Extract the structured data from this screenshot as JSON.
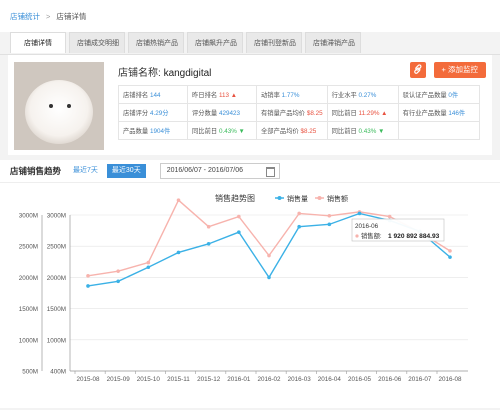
{
  "breadcrumb": {
    "root": "店铺统计",
    "current": "店铺详情"
  },
  "tabs": [
    {
      "label": "店铺详情",
      "active": true
    },
    {
      "label": "店铺成交明细",
      "active": false
    },
    {
      "label": "店铺热销产品",
      "active": false
    },
    {
      "label": "店铺飙升产品",
      "active": false
    },
    {
      "label": "店铺刊登新品",
      "active": false
    },
    {
      "label": "店铺滞销产品",
      "active": false
    }
  ],
  "shop": {
    "name_label": "店铺名称:",
    "name": "kangdigital",
    "monitor_button": "+ 添加监控"
  },
  "stats": {
    "r1": {
      "a_label": "店铺排名",
      "a_val": "144",
      "b_label": "昨日排名",
      "b_val": "113",
      "c_label": "动销率",
      "c_val": "1.77%",
      "d_label": "行业水平",
      "d_val": "0.27%",
      "e_label": "驳认证产品数量",
      "e_val": "0件"
    },
    "r2": {
      "a_label": "店铺评分",
      "a_val": "4.29分",
      "b_label": "评分数量",
      "b_val": "429423",
      "c_label": "有销量产品均价",
      "c_val": "$8.25",
      "d_label": "同比前日",
      "d_val": "11.29%",
      "e_label": "有行业产品数量",
      "e_val": "146件"
    },
    "r3": {
      "a_label": "产品数量",
      "a_val": "1904件",
      "b_label": "同比前日",
      "b_val": "0.43%",
      "c_label": "全部产品均价",
      "c_val": "$8.25",
      "d_label": "同比前日",
      "d_val": "0.43%"
    }
  },
  "trend": {
    "title": "店铺销售趋势",
    "range_7": "最近7天",
    "range_30": "最近30天",
    "date_range": "2016/06/07 - 2016/07/06"
  },
  "colors": {
    "volume": "#3bb1e6",
    "amount": "#f7b3ad",
    "accent": "#f36b3b",
    "link": "#3a8fd8"
  },
  "chart_data": {
    "type": "line",
    "title": "销售趋势图",
    "categories": [
      "2015-08",
      "2015-09",
      "2015-10",
      "2015-11",
      "2015-12",
      "2016-01",
      "2016-02",
      "2016-03",
      "2016-04",
      "2016-05",
      "2016-06",
      "2016-07",
      "2016-08"
    ],
    "series": [
      {
        "name": "销售量",
        "values": [
          945,
          975,
          1065,
          1160,
          1215,
          1290,
          1000,
          1325,
          1340,
          1410,
          1365,
          1295,
          1130
        ]
      },
      {
        "name": "销售额",
        "values": [
          1010,
          1040,
          1095,
          1495,
          1325,
          1390,
          1140,
          1410,
          1395,
          1420,
          1390,
          1290,
          1170
        ]
      }
    ],
    "ylim": [
      400,
      1400
    ],
    "y_ticks": [
      "400M",
      "1000M",
      "1500M",
      "2000M",
      "2500M",
      "3000M"
    ],
    "y_axis_ticks": [
      "500M",
      "1000M",
      "1500M",
      "2000M",
      "2500M",
      "3000M"
    ],
    "tooltip": {
      "title": "2016-06",
      "label": "销售额:",
      "value": "1 920 892 884.93"
    },
    "legend_position": "top"
  }
}
